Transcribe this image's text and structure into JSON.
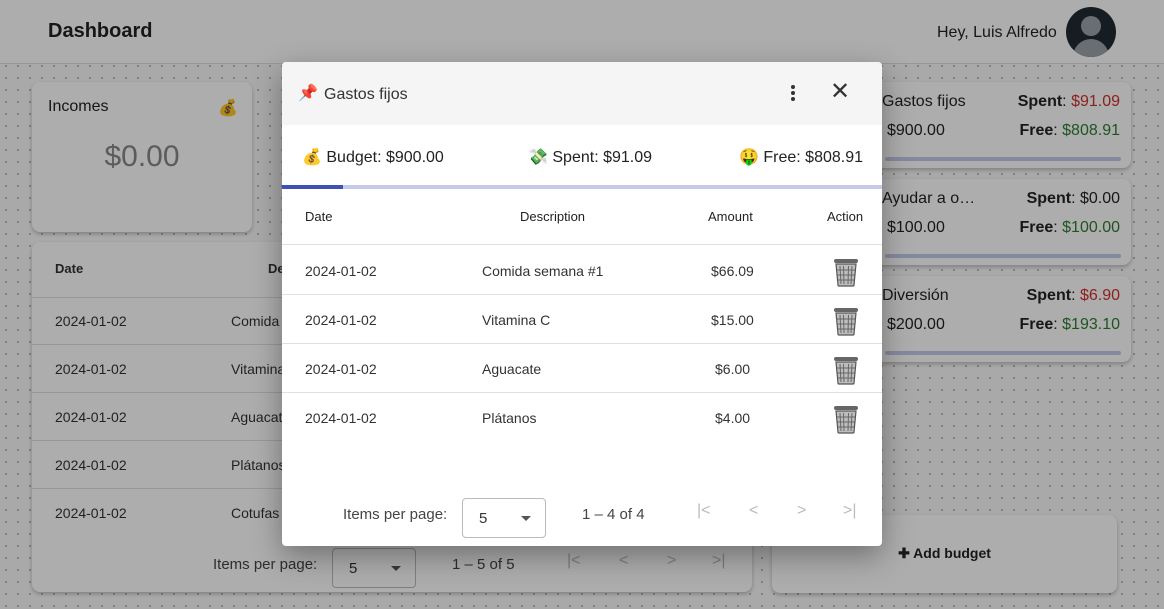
{
  "header": {
    "title": "Dashboard",
    "greeting": "Hey, Luis Alfredo"
  },
  "incomes": {
    "label": "Incomes",
    "icon": "money-bag-icon",
    "value": "$0.00"
  },
  "transactions": {
    "columns": [
      "Date",
      "De"
    ],
    "rows": [
      {
        "date": "2024-01-02",
        "desc": "Comida"
      },
      {
        "date": "2024-01-02",
        "desc": "Vitamina"
      },
      {
        "date": "2024-01-02",
        "desc": "Aguacat"
      },
      {
        "date": "2024-01-02",
        "desc": "Plátanos"
      },
      {
        "date": "2024-01-02",
        "desc": "Cotufas"
      }
    ],
    "pager": {
      "items_label": "Items per page:",
      "page_size": "5",
      "range": "1 – 5 of 5"
    }
  },
  "budgets": [
    {
      "name": "Gastos fijos",
      "amount": "$900.00",
      "spent_label": "Spent",
      "spent": "$91.09",
      "spent_color": "red",
      "free_label": "Free",
      "free": "$808.91"
    },
    {
      "name": "Ayudar a o…",
      "amount": "$100.00",
      "spent_label": "Spent",
      "spent": "$0.00",
      "spent_color": "neutral",
      "free_label": "Free",
      "free": "$100.00"
    },
    {
      "name": "Diversión",
      "amount": "$200.00",
      "spent_label": "Spent",
      "spent": "$6.90",
      "spent_color": "red",
      "free_label": "Free",
      "free": "$193.10"
    }
  ],
  "add_budget": {
    "label": "Add budget",
    "icon": "plus-icon"
  },
  "dialog": {
    "title": "Gastos fijos",
    "title_icon": "pushpin-icon",
    "budget": "Budget: $900.00",
    "spent": "Spent: $91.09",
    "free": "Free: $808.91",
    "progress_fraction": 0.1012,
    "columns": {
      "date": "Date",
      "description": "Description",
      "amount": "Amount",
      "action": "Action"
    },
    "rows": [
      {
        "date": "2024-01-02",
        "description": "Comida semana #1",
        "amount": "$66.09"
      },
      {
        "date": "2024-01-02",
        "description": "Vitamina C",
        "amount": "$15.00"
      },
      {
        "date": "2024-01-02",
        "description": "Aguacate",
        "amount": "$6.00"
      },
      {
        "date": "2024-01-02",
        "description": "Plátanos",
        "amount": "$4.00"
      }
    ],
    "pager": {
      "items_label": "Items per page:",
      "page_size": "5",
      "range": "1 – 4 of 4"
    }
  },
  "colors": {
    "accent": "#3f51b5",
    "track": "#c5cae9",
    "spent_red": "#d32f2f",
    "free_green": "#2e7d32"
  }
}
